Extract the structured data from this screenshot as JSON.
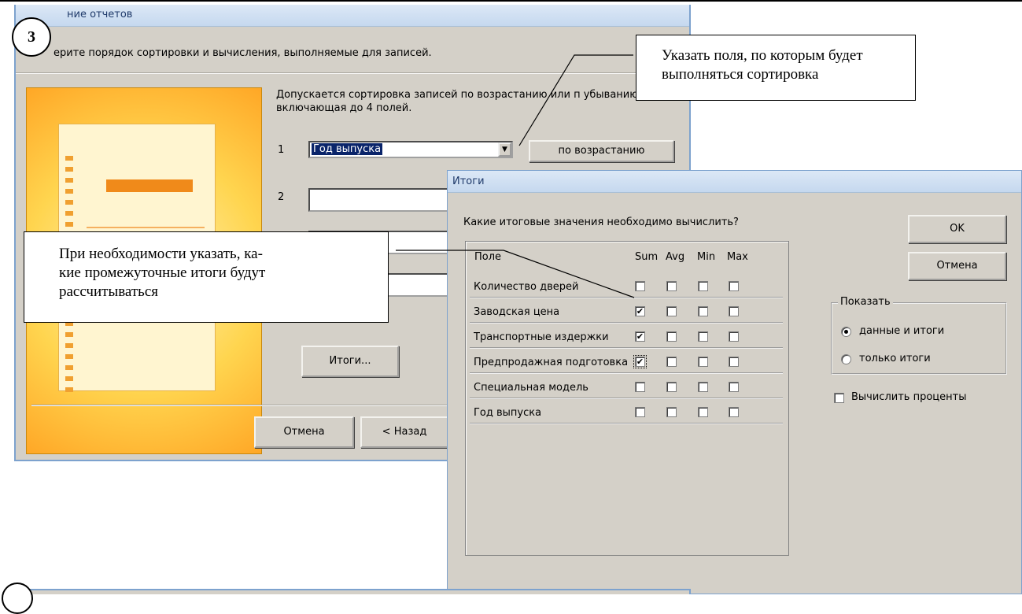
{
  "wizard": {
    "title": "ние отчетов",
    "instruction": "ерите порядок сортировки и вычисления, выполняемые для записей.",
    "description": "Допускается сортировка записей по возрастанию или п убыванию, включающая до 4 полей.",
    "sort_rows": [
      {
        "num": "1",
        "value": "Год выпуска",
        "order_label": "по возрастанию"
      },
      {
        "num": "2",
        "value": ""
      }
    ],
    "totals_button": "Итоги...",
    "cancel_button": "Отмена",
    "back_button": "< Назад"
  },
  "totals": {
    "title": "Итоги",
    "question": "Какие итоговые значения необходимо вычислить?",
    "headers": {
      "field": "Поле",
      "sum": "Sum",
      "avg": "Avg",
      "min": "Min",
      "max": "Max"
    },
    "rows": [
      {
        "name": "Количество дверей",
        "sum": false,
        "avg": false,
        "min": false,
        "max": false
      },
      {
        "name": "Заводская цена",
        "sum": true,
        "avg": false,
        "min": false,
        "max": false
      },
      {
        "name": "Транспортные издержки",
        "sum": true,
        "avg": false,
        "min": false,
        "max": false
      },
      {
        "name": "Предпродажная подготовка",
        "sum": true,
        "avg": false,
        "min": false,
        "max": false
      },
      {
        "name": "Специальная модель",
        "sum": false,
        "avg": false,
        "min": false,
        "max": false
      },
      {
        "name": "Год выпуска",
        "sum": false,
        "avg": false,
        "min": false,
        "max": false
      }
    ],
    "ok_button": "OK",
    "cancel_button": "Отмена",
    "show_group": "Показать",
    "option_data_and_totals": "данные и итоги",
    "option_totals_only": "только итоги",
    "selected_option": "data_and_totals",
    "percent_label": "Вычислить проценты",
    "percent_checked": false
  },
  "callouts": {
    "step_number": "3",
    "sort_hint": "Указать поля, по которым будет выполняться сортировка",
    "totals_hint": "При необходимости указать, какие промежуточные итоги будут рассчитываться",
    "totals_hint_line1": "При необходимости указать, ка-",
    "totals_hint_line2": "кие промежуточные итоги будут",
    "totals_hint_line3": "рассчитываться"
  },
  "icons": {
    "combo_arrow": "▼",
    "check": "✔"
  }
}
